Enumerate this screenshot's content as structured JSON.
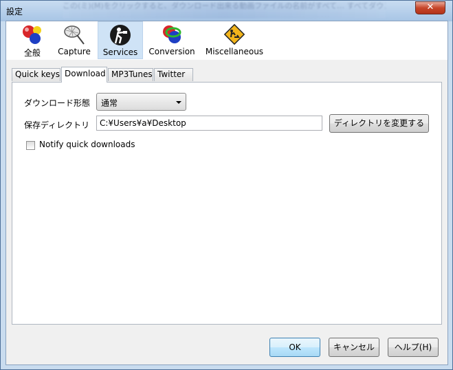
{
  "window": {
    "title": "設定",
    "blurred_background_text": "この(ミ)(M)をクリックすると、ダウンロード出来る動画ファイルの名前がすべて…  すべてダウンロードすることができます"
  },
  "toolbar": {
    "items": [
      {
        "label": "全般",
        "icon": "general-balls-icon"
      },
      {
        "label": "Capture",
        "icon": "net-capture-icon"
      },
      {
        "label": "Services",
        "icon": "services-person-icon"
      },
      {
        "label": "Conversion",
        "icon": "conversion-balls-icon"
      },
      {
        "label": "Miscellaneous",
        "icon": "misc-warning-sign-icon"
      }
    ],
    "active": "Services"
  },
  "tabs": {
    "items": [
      "Quick keys",
      "Download",
      "MP3Tunes",
      "Twitter"
    ],
    "active": "Download"
  },
  "download": {
    "format_label": "ダウンロード形態",
    "format_value": "通常",
    "directory_label": "保存ディレクトリ",
    "directory_value": "C:¥Users¥a¥Desktop",
    "change_directory_button": "ディレクトリを変更する",
    "notify_label": "Notify quick downloads",
    "notify_checked": false
  },
  "buttons": {
    "ok": "OK",
    "cancel": "キャンセル",
    "help": "ヘルプ(H)"
  },
  "colors": {
    "active_tab_highlight": "#cfe3f6",
    "close_button": "#c7462a"
  }
}
